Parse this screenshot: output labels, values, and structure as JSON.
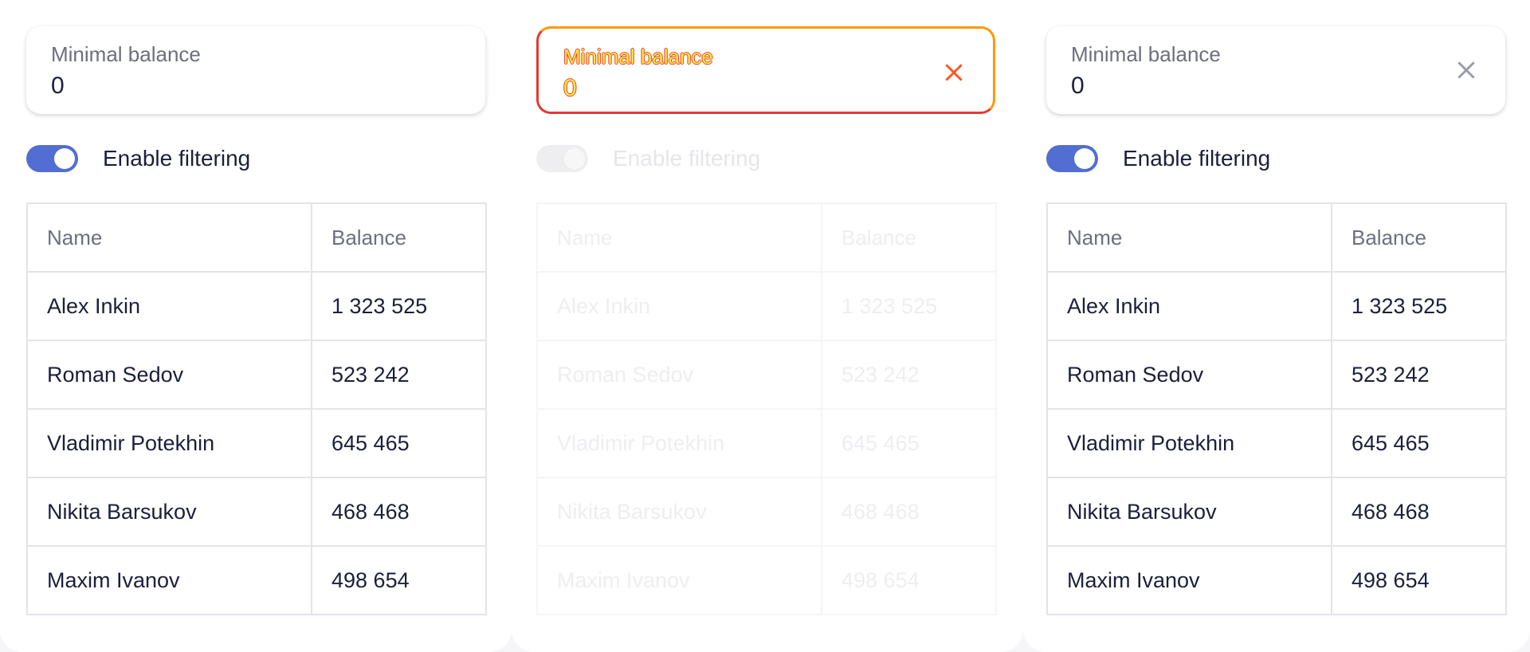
{
  "panels": [
    {
      "field": {
        "label": "Minimal balance",
        "value": "0"
      },
      "toggle": {
        "label": "Enable filtering",
        "on": true
      },
      "table": {
        "headers": [
          "Name",
          "Balance"
        ],
        "rows": [
          [
            "Alex Inkin",
            "1 323 525"
          ],
          [
            "Roman Sedov",
            "523 242"
          ],
          [
            "Vladimir Potekhin",
            "645 465"
          ],
          [
            "Nikita Barsukov",
            "468 468"
          ],
          [
            "Maxim Ivanov",
            "498 654"
          ]
        ]
      }
    },
    {
      "field": {
        "label": "Minimal balance",
        "value": "0",
        "clear_icon": "close-icon"
      },
      "toggle": {
        "label": "Enable filtering",
        "on": true,
        "disabled": true
      },
      "table": {
        "headers": [
          "Name",
          "Balance"
        ],
        "rows": [
          [
            "Alex Inkin",
            "1 323 525"
          ],
          [
            "Roman Sedov",
            "523 242"
          ],
          [
            "Vladimir Potekhin",
            "645 465"
          ],
          [
            "Nikita Barsukov",
            "468 468"
          ],
          [
            "Maxim Ivanov",
            "498 654"
          ]
        ]
      }
    },
    {
      "field": {
        "label": "Minimal balance",
        "value": "0",
        "clear_icon": "close-icon"
      },
      "toggle": {
        "label": "Enable filtering",
        "on": true
      },
      "table": {
        "headers": [
          "Name",
          "Balance"
        ],
        "rows": [
          [
            "Alex Inkin",
            "1 323 525"
          ],
          [
            "Roman Sedov",
            "523 242"
          ],
          [
            "Vladimir Potekhin",
            "645 465"
          ],
          [
            "Nikita Barsukov",
            "468 468"
          ],
          [
            "Maxim Ivanov",
            "498 654"
          ]
        ]
      }
    }
  ],
  "colors": {
    "accent": "#526ed3",
    "text": "#1b1f3b",
    "muted": "#6c6f7e",
    "border": "#e3e4e8",
    "clear_icon_panel2": "#ff5722",
    "clear_icon_panel3": "#9a9cab"
  }
}
